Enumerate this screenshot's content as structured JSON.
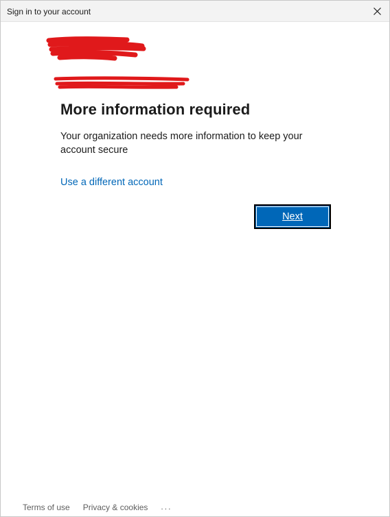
{
  "window": {
    "title": "Sign in to your account"
  },
  "main": {
    "heading": "More information required",
    "description": "Your organization needs more information to keep your account secure",
    "alt_account_link": "Use a different account",
    "next_label": "Next"
  },
  "footer": {
    "terms_label": "Terms of use",
    "privacy_label": "Privacy & cookies",
    "more_label": "..."
  },
  "colors": {
    "accent": "#0067b8",
    "redaction": "#e0191b"
  }
}
